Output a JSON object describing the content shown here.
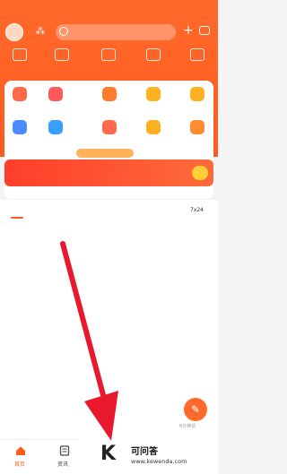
{
  "status": {
    "time": "",
    "icons": ""
  },
  "header": {
    "search_placeholder": "",
    "top_icons": [
      "",
      "",
      "",
      "",
      ""
    ]
  },
  "services": {
    "row1": [
      "",
      "",
      "",
      "",
      "",
      ""
    ],
    "row2": [
      "",
      "",
      "",
      "",
      "",
      ""
    ],
    "colors": [
      "#ff6a4a",
      "#ff5a5a",
      "#ff7b2e",
      "#ffb020",
      "#ffb020",
      "#ff8c2e"
    ]
  },
  "banner": {
    "tag": "",
    "text1": "",
    "text2": "",
    "go": ""
  },
  "tabs": [
    "",
    "",
    "",
    "",
    "",
    "",
    "7x24"
  ],
  "feed": {
    "items": [
      {
        "line1": "",
        "line2": "",
        "meta": ""
      },
      {
        "line1": "",
        "line2": "",
        "meta": ""
      },
      {
        "line1": "",
        "line2": "",
        "meta": ""
      },
      {
        "line1": "",
        "line2": "",
        "meta": ""
      }
    ],
    "fab_label": "6分钟前"
  },
  "nav": {
    "home": "首页",
    "news": "资讯"
  },
  "watermark": {
    "title": "可问答",
    "url": "www.kewenda.com"
  },
  "colors": {
    "brand": "#ff5a1e",
    "arrow": "#e8192c"
  }
}
